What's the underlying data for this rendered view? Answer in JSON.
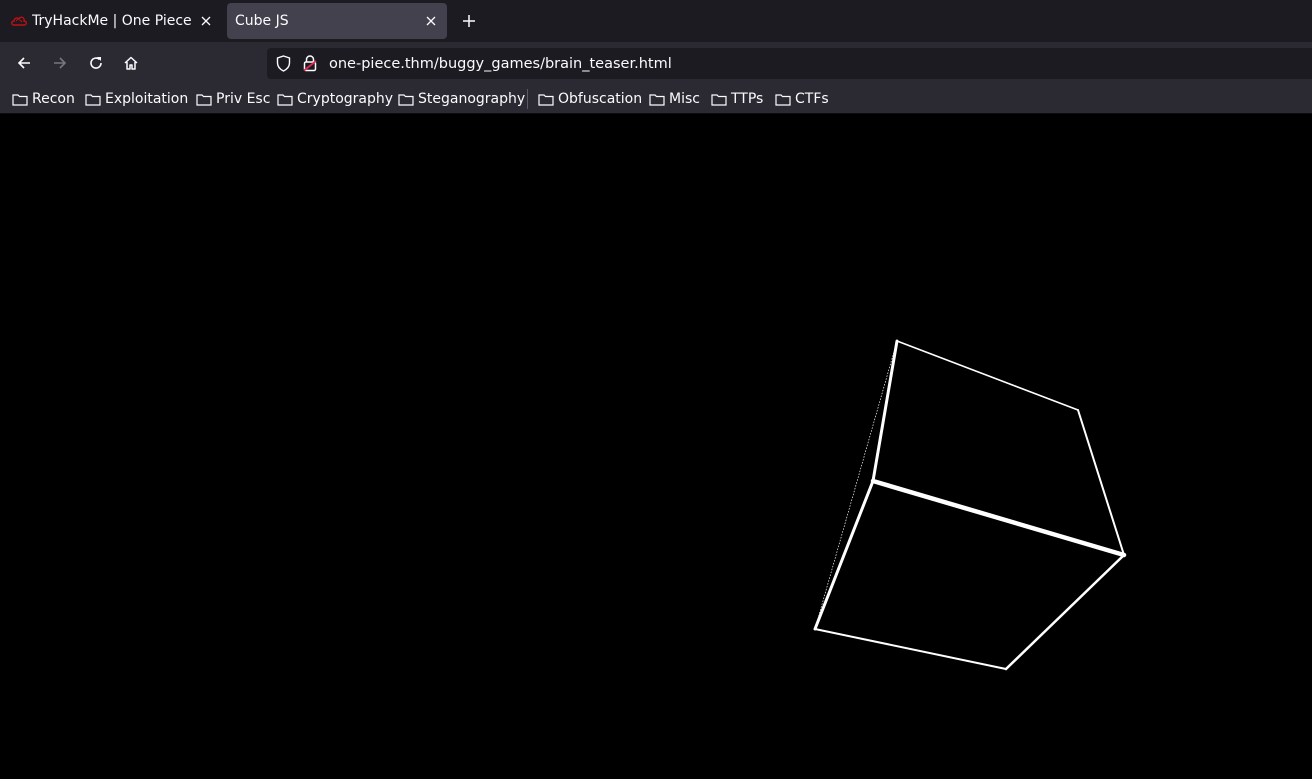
{
  "tabs": [
    {
      "title": "TryHackMe | One Piece",
      "favicon": "tryhackme-cloud-icon",
      "active": false
    },
    {
      "title": "Cube JS",
      "favicon": "",
      "active": true
    }
  ],
  "nav": {
    "url": "one-piece.thm/buggy_games/brain_teaser.html"
  },
  "bookmarks": [
    {
      "label": "Recon"
    },
    {
      "label": "Exploitation"
    },
    {
      "label": "Priv Esc"
    },
    {
      "label": "Cryptography"
    },
    {
      "label": "Steganography"
    },
    {
      "label": "Obfuscation"
    },
    {
      "label": "Misc"
    },
    {
      "label": "TTPs"
    },
    {
      "label": "CTFs"
    }
  ],
  "colors": {
    "tab_strip": "#1c1b22",
    "toolbar": "#2b2a33",
    "active_tab": "#42414d",
    "page_background": "#000000",
    "cube_stroke": "#ffffff"
  },
  "canvas": {
    "content": "rotating-wireframe-cube"
  }
}
